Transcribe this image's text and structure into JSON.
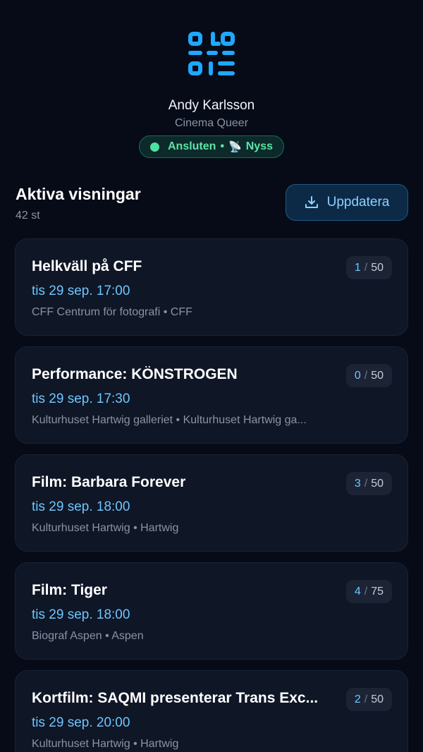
{
  "header": {
    "logo_icon": "qr-code-icon",
    "user_name": "Andy Karlsson",
    "organization": "Cinema Queer",
    "status": {
      "label": "Ansluten",
      "separator": "•",
      "sync_icon": "📡",
      "sync_text": "Nyss",
      "color": "#5ee3a8"
    }
  },
  "section": {
    "title": "Aktiva visningar",
    "count": "42 st",
    "refresh_label": "Uppdatera",
    "refresh_icon": "download-icon"
  },
  "events": [
    {
      "title": "Helkväll på CFF",
      "time": "tis 29 sep. 17:00",
      "venue": "CFF Centrum för fotografi • CFF",
      "checked": "1",
      "capacity": "50"
    },
    {
      "title": "Performance: KÖNSTROGEN",
      "time": "tis 29 sep. 17:30",
      "venue": "Kulturhuset Hartwig galleriet • Kulturhuset Hartwig ga...",
      "checked": "0",
      "capacity": "50"
    },
    {
      "title": "Film: Barbara Forever",
      "time": "tis 29 sep. 18:00",
      "venue": "Kulturhuset Hartwig • Hartwig",
      "checked": "3",
      "capacity": "50"
    },
    {
      "title": "Film: Tiger",
      "time": "tis 29 sep. 18:00",
      "venue": "Biograf Aspen • Aspen",
      "checked": "4",
      "capacity": "75"
    },
    {
      "title": "Kortfilm: SAQMI presenterar Trans Exc...",
      "time": "tis 29 sep. 20:00",
      "venue": "Kulturhuset Hartwig • Hartwig",
      "checked": "2",
      "capacity": "50"
    }
  ],
  "badge_separator": "/",
  "colors": {
    "background": "#060b17",
    "card": "#0f1626",
    "accent": "#6ec6ff",
    "status_green": "#4ee29f"
  }
}
